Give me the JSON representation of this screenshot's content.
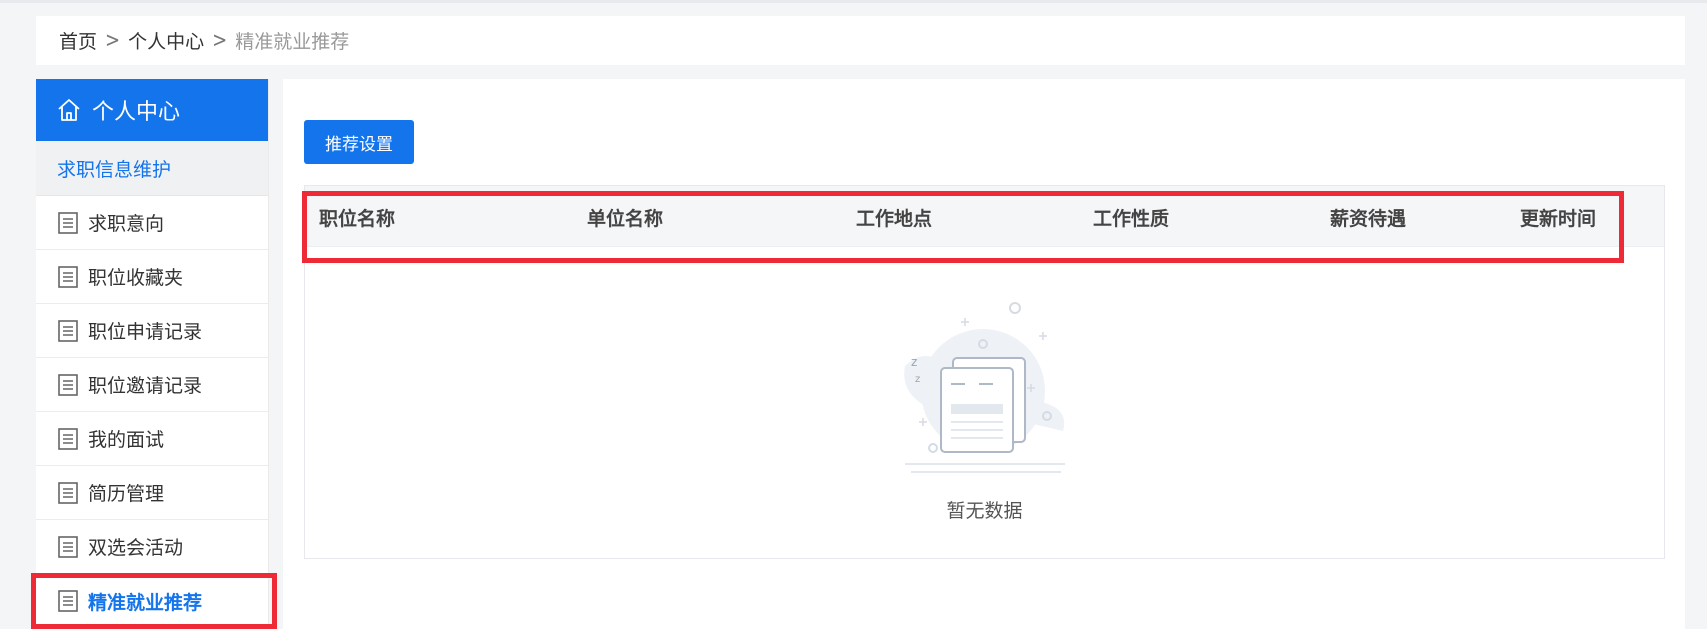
{
  "breadcrumb": {
    "items": [
      "首页",
      "个人中心",
      "精准就业推荐"
    ],
    "separator": ">"
  },
  "sidebar": {
    "header": "个人中心",
    "group": "求职信息维护",
    "items": [
      {
        "label": "求职意向"
      },
      {
        "label": "职位收藏夹"
      },
      {
        "label": "职位申请记录"
      },
      {
        "label": "职位邀请记录"
      },
      {
        "label": "我的面试"
      },
      {
        "label": "简历管理"
      },
      {
        "label": "双选会活动"
      },
      {
        "label": "精准就业推荐",
        "active": true
      }
    ]
  },
  "main": {
    "settings_button": "推荐设置",
    "table": {
      "columns": [
        "职位名称",
        "单位名称",
        "工作地点",
        "工作性质",
        "薪资待遇",
        "更新时间"
      ],
      "rows": [],
      "empty_text": "暂无数据"
    }
  },
  "colors": {
    "primary": "#1474ec",
    "highlight": "#ee2a36",
    "sidebar_group_bg": "#f0f1f3",
    "table_header_bg": "#f5f6f8"
  },
  "icons": {
    "home": "home-icon",
    "menu_item": "document-list-icon",
    "empty": "empty-state-illustration",
    "separator": "chevron-right-icon"
  }
}
